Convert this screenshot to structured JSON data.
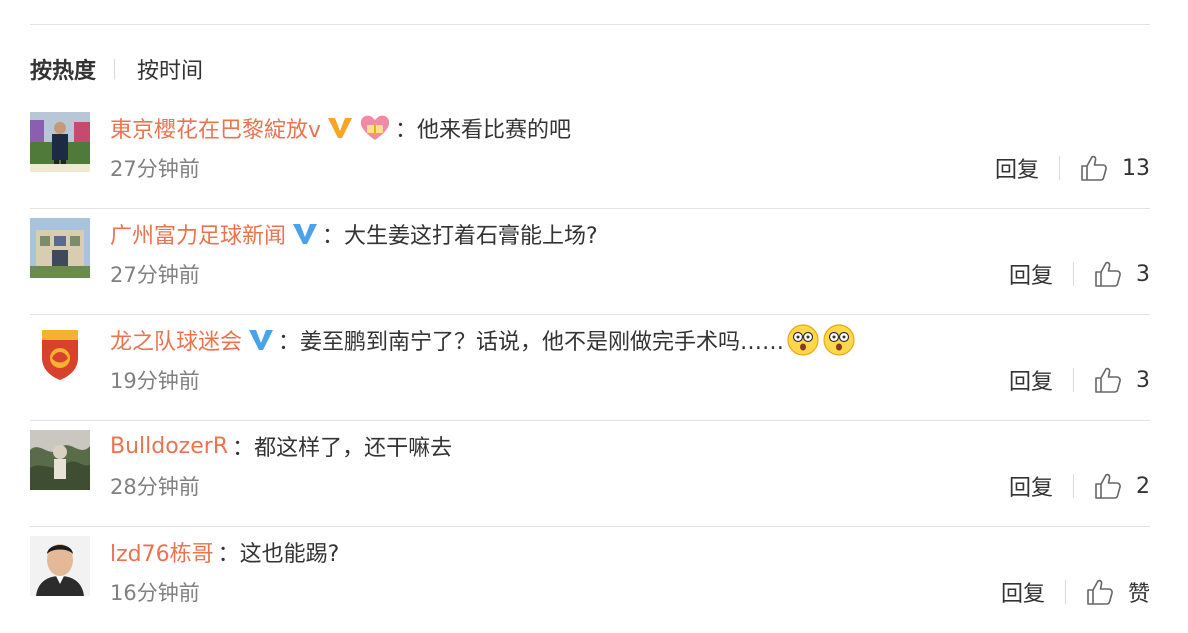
{
  "sort": {
    "hot_label": "按热度",
    "time_label": "按时间"
  },
  "comments": [
    {
      "username": "東京櫻花在巴黎綻放v",
      "badge": "gold-v",
      "heart": true,
      "text": "他来看比赛的吧",
      "emoji": false,
      "time": "27分钟前",
      "reply_label": "回复",
      "likes": "13"
    },
    {
      "username": "广州富力足球新闻",
      "badge": "blue-v",
      "heart": false,
      "text": "大生姜这打着石膏能上场?",
      "emoji": false,
      "time": "27分钟前",
      "reply_label": "回复",
      "likes": "3"
    },
    {
      "username": "龙之队球迷会",
      "badge": "blue-v",
      "heart": false,
      "text": "姜至鹏到南宁了？话说，他不是刚做完手术吗……",
      "emoji": true,
      "time": "19分钟前",
      "reply_label": "回复",
      "likes": "3"
    },
    {
      "username": "BulldozerR",
      "badge": "",
      "heart": false,
      "text": "都这样了，还干嘛去",
      "emoji": false,
      "time": "28分钟前",
      "reply_label": "回复",
      "likes": "2"
    },
    {
      "username": "lzd76栋哥",
      "badge": "",
      "heart": false,
      "text": "这也能踢?",
      "emoji": false,
      "time": "16分钟前",
      "reply_label": "回复",
      "likes": "赞"
    }
  ],
  "colon": "：",
  "colors": {
    "username": "#eb7350",
    "gold_badge": "#f5a623",
    "blue_badge": "#4aa3e8",
    "divider": "#e3e3e3"
  }
}
